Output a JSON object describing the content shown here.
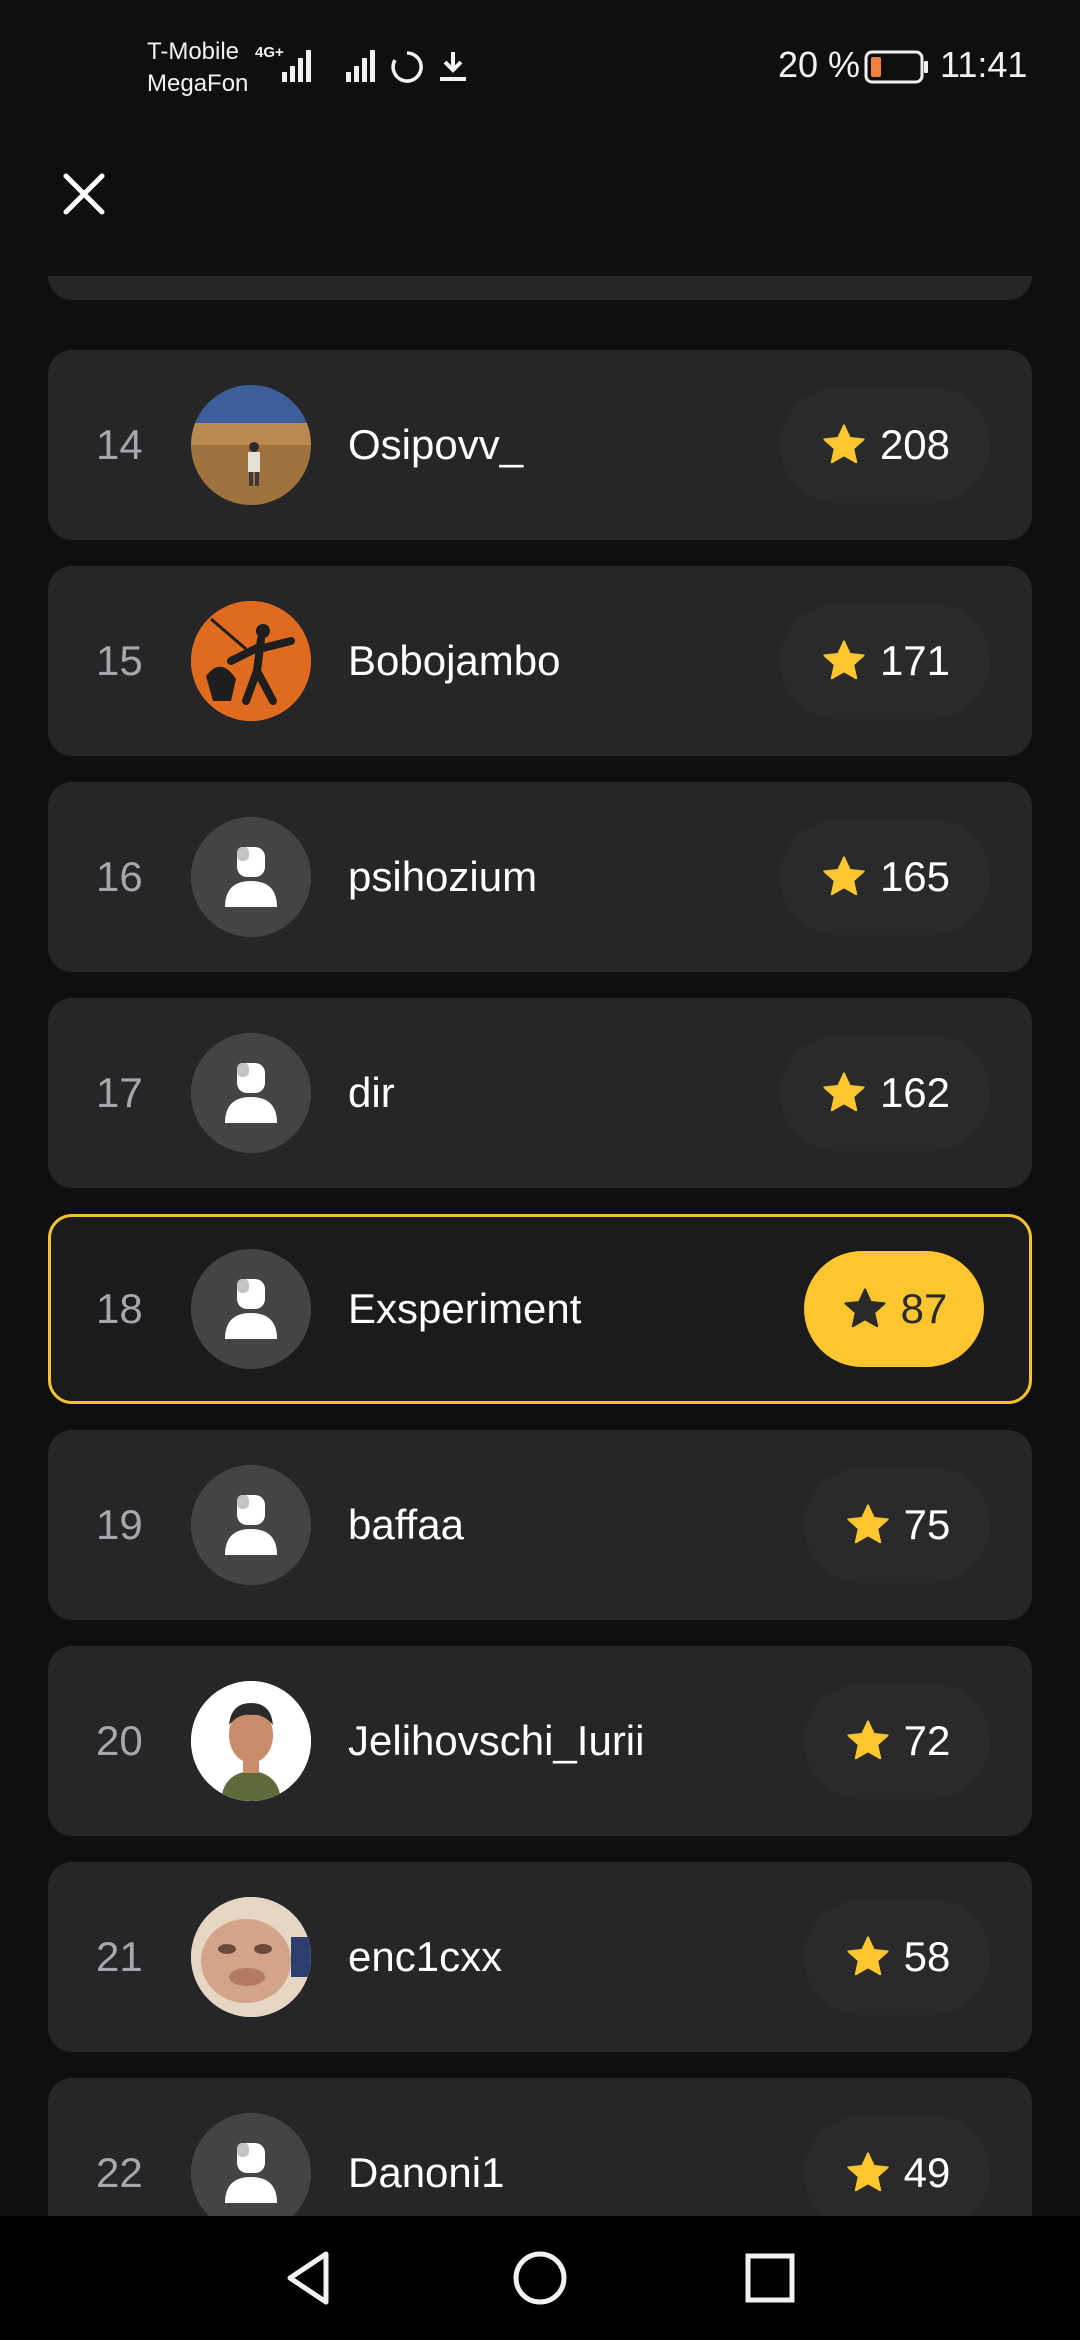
{
  "status_bar": {
    "carrier_1": "T-Mobile",
    "carrier_2": "MegaFon",
    "network_type": "4G+",
    "battery_percent": "20 %",
    "time": "11:41"
  },
  "header": {
    "close_icon": "close-icon"
  },
  "leaderboard": {
    "entries": [
      {
        "rank": "14",
        "name": "Osipovv_",
        "score": "208",
        "avatar": "photo-desert"
      },
      {
        "rank": "15",
        "name": "Bobojambo",
        "score": "171",
        "avatar": "photo-orange"
      },
      {
        "rank": "16",
        "name": "psihozium",
        "score": "165",
        "avatar": "default-user"
      },
      {
        "rank": "17",
        "name": "dir",
        "score": "162",
        "avatar": "default-user"
      },
      {
        "rank": "18",
        "name": "Exsperiment",
        "score": "87",
        "avatar": "default-user",
        "current_user": true
      },
      {
        "rank": "19",
        "name": "baffaa",
        "score": "75",
        "avatar": "default-user"
      },
      {
        "rank": "20",
        "name": "Jelihovschi_Iurii",
        "score": "72",
        "avatar": "photo-portrait"
      },
      {
        "rank": "21",
        "name": "enc1cxx",
        "score": "58",
        "avatar": "photo-face"
      },
      {
        "rank": "22",
        "name": "Danoni1",
        "score": "49",
        "avatar": "default-user"
      }
    ]
  },
  "colors": {
    "background": "#0f0f10",
    "row": "#262628",
    "highlight_border": "#f1c232",
    "star": "#fdc62f",
    "rank_text": "#a7a7ab"
  },
  "nav": {
    "back_icon": "back-triangle-icon",
    "home_icon": "home-circle-icon",
    "recents_icon": "recents-square-icon"
  }
}
